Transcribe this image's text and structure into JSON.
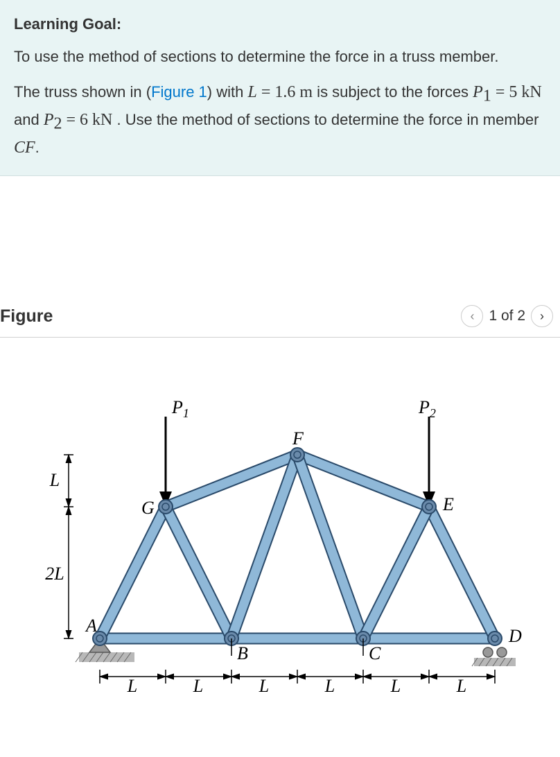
{
  "learning_goal": {
    "title": "Learning Goal:",
    "text": "To use the method of sections to determine the force in a truss member."
  },
  "problem": {
    "prefix": "The truss shown in (",
    "figure_link": "Figure 1",
    "after_link": ") with ",
    "L_var": "L",
    "L_eq": " = 1.6 ",
    "L_unit": "m",
    "mid1": " is subject to the forces ",
    "P1_var": "P",
    "P1_sub": "1",
    "P1_eq": " = 5 ",
    "P1_unit": "kN",
    "and": " and ",
    "P2_var": "P",
    "P2_sub": "2",
    "P2_eq": " = 6 ",
    "P2_unit": "kN",
    "end1": " . Use the method of sections to determine the force in member ",
    "member": "CF",
    "period": "."
  },
  "figure": {
    "title": "Figure",
    "pager_text": "1 of 2"
  },
  "labels": {
    "P1": "P",
    "P1_sub": "1",
    "P2": "P",
    "P2_sub": "2",
    "A": "A",
    "B": "B",
    "C": "C",
    "D": "D",
    "E": "E",
    "F": "F",
    "G": "G",
    "L": "L",
    "twoL": "2L"
  }
}
